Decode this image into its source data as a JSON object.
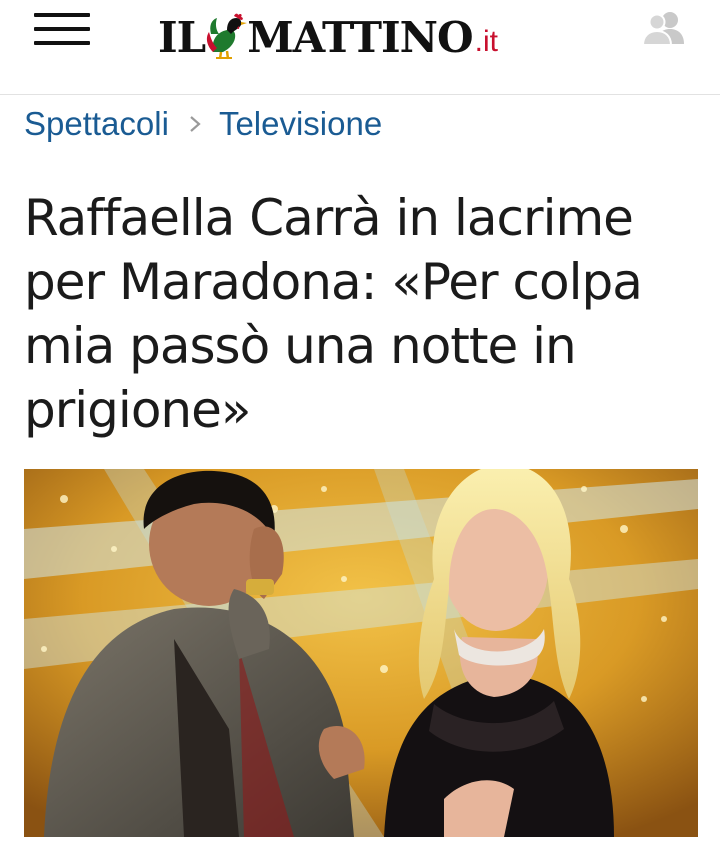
{
  "header": {
    "logo": {
      "part1": "IL",
      "part2": "MATTINO",
      "tld": ".it"
    },
    "menu_icon": "hamburger-menu-icon",
    "user_icon": "user-account-icon"
  },
  "breadcrumb": {
    "section": "Spettacoli",
    "separator_icon": "chevron-right-icon",
    "subsection": "Televisione"
  },
  "article": {
    "headline": "Raffaella Carrà in lacrime per Maradona: «Per colpa mia passò una notte in prigione»",
    "photo_icon": "article-hero-photo"
  },
  "colors": {
    "brand_red": "#c8102e",
    "link_blue": "#1a5b93",
    "headline_text": "#1b1b1b"
  }
}
